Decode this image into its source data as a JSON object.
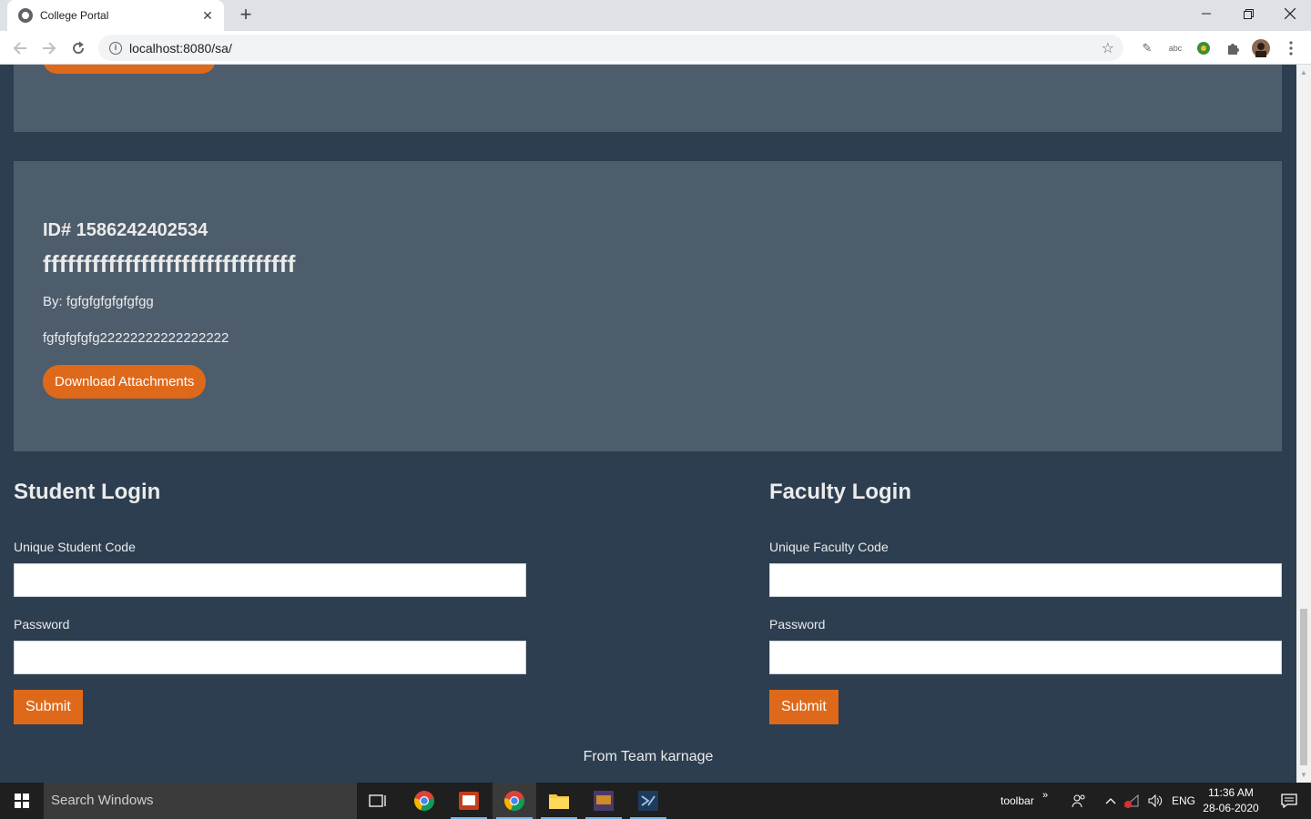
{
  "browser": {
    "tab_title": "College Portal",
    "tab_close": "✕",
    "new_tab": "+",
    "url": "localhost:8080/sa/"
  },
  "post": {
    "id": "ID# 1586242402534",
    "title": "fffffffffffffffffffffffffffffff",
    "by": "By: fgfgfgfgfgfgfgg",
    "body": "fgfgfgfgfg22222222222222222",
    "download_label": "Download Attachments"
  },
  "student_login": {
    "heading": "Student Login",
    "code_label": "Unique Student Code",
    "code_value": "",
    "password_label": "Password",
    "password_value": "",
    "submit_label": "Submit"
  },
  "faculty_login": {
    "heading": "Faculty Login",
    "code_label": "Unique Faculty Code",
    "code_value": "",
    "password_label": "Password",
    "password_value": "",
    "submit_label": "Submit"
  },
  "footer": {
    "text": "From Team karnage"
  },
  "taskbar": {
    "search_placeholder": "Search Windows",
    "toolbar_label": "toolbar",
    "language": "ENG",
    "time": "11:36 AM",
    "date": "28-06-2020"
  },
  "colors": {
    "page_bg": "#2c3e50",
    "card_bg": "#4e5d6c",
    "accent": "#df691a"
  }
}
